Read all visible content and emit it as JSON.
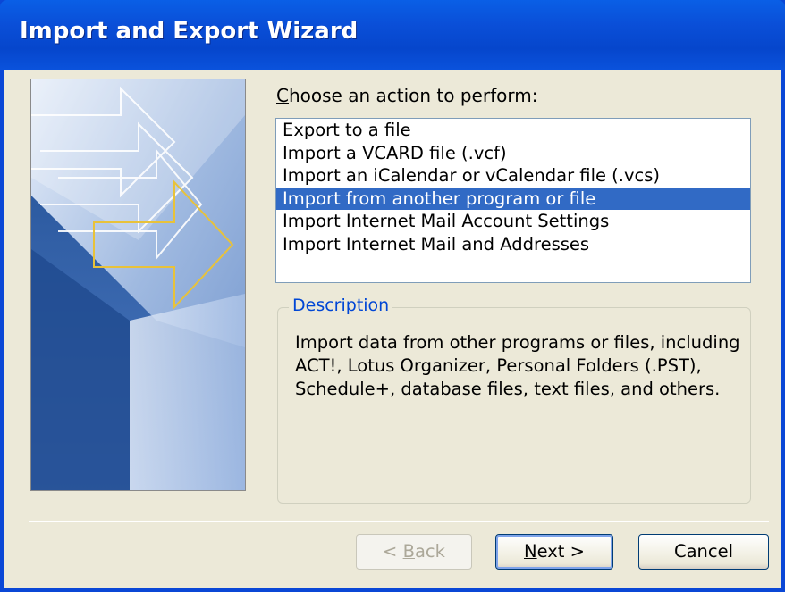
{
  "window": {
    "title": "Import and Export Wizard"
  },
  "prompt": {
    "accesskey": "C",
    "rest": "hoose an action to perform:"
  },
  "actions": {
    "items": [
      "Export to a file",
      "Import a VCARD file (.vcf)",
      "Import an iCalendar or vCalendar file (.vcs)",
      "Import from another program or file",
      "Import Internet Mail Account Settings",
      "Import Internet Mail and Addresses"
    ],
    "selected_item": "Import from another program or file"
  },
  "description": {
    "legend": "Description",
    "text": "Import data from other programs or files, including\nACT!, Lotus Organizer, Personal Folders (.PST),\nSchedule+, database files, text files, and others."
  },
  "buttons": {
    "back_prefix": "< ",
    "back_key": "B",
    "back_rest": "ack",
    "next_key": "N",
    "next_rest": "ext >",
    "cancel": "Cancel"
  },
  "colors": {
    "title_bar": "#0a4fd8",
    "selection": "#316ac5",
    "dialog_face": "#ece9d8",
    "group_legend": "#0046d5"
  },
  "icons": {
    "banner_graphic": "arrow-banner-illustration"
  }
}
